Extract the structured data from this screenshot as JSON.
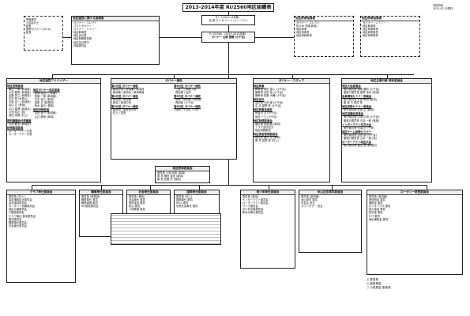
{
  "header": {
    "title": "2013-2014年度 RI/2560地区組織表",
    "meta_top": "内部資料",
    "meta_bottom": "2013.07.03現在"
  },
  "ri": {
    "line1": "R I （2013-14年度）",
    "line2": "会 長 ロン D.バートン(ノーマン)"
  },
  "governor": {
    "line1": "R I D2560 （2013-2014年度）",
    "line2": "ガバナー 山崎 聖輔 (小千谷)"
  },
  "left_dashed": {
    "lines": [
      "財務委員",
      "公認会計士",
      "議長",
      "国際ガバナンス(ICG)",
      "議長"
    ]
  },
  "left_upper": {
    "title": "地区運営に関する指導者",
    "lines": [
      "ガバナー・エレクト",
      "パストガバナー",
      "ガバナー・ノミニー",
      "地区幹事長",
      "地区会計長",
      "地区財務委員長",
      "地区会計長付",
      "評議委員会"
    ]
  },
  "right_upper_1": {
    "title": "地区研修指導者",
    "lines": [
      "ガバナー・エレクト",
      "佐々木 芳雄(新潟)",
      "地区幹事",
      "地区研修長",
      "地区研修幹事"
    ]
  },
  "right_upper_2": {
    "title": "地区研修指導者",
    "lines": [
      "ガバナー・ノミニー",
      "地区幹事長",
      "地区研修幹事",
      "地区研修委員",
      "地区研修委員"
    ]
  },
  "col_adviser": {
    "title": "地区運営アドバイザー",
    "sections": [
      {
        "head": "地区諮問委員",
        "rows": [
          "東山 一郎 (新潟南)",
          "大島 勝男 (新潟東)",
          "遠藤 秀之 (新発田)",
          "石本 豊 (糸魚川)",
          "中嶋 清一 (新潟西)",
          "谷口 正 (長岡)",
          "山口 康博 (新潟北)",
          "川西 成正 (燕)",
          "西田 幸雄 (村上)"
        ]
      },
      {
        "head": "地区ガバナー指名委員",
        "rows": [
          "関澤 信吾 (三条南)",
          "佐藤 一郎 (新潟東)",
          "石本 裕之 (新潟)",
          "高野 正 (新発田)",
          "鈴木 喜代 (長岡)"
        ]
      },
      {
        "head": "地区研修委員",
        "rows": [
          "吉田 幸一 (新潟東)",
          "山口 勝彦 (新潟)"
        ]
      },
      {
        "head": "規則審議会代表議員",
        "rows": [
          "山岸 敏夫 (新潟北)"
        ]
      },
      {
        "head": "紀律事項委員",
        "rows": [
          "ローターアクト代表",
          "ローターアクト代表"
        ]
      }
    ]
  },
  "col_gov_support": {
    "title": "ガバナー補佐",
    "groups": [
      {
        "head": "第1分区 ガバナー補佐",
        "rows": [
          "新潟中央 / 新潟東 / 新潟西",
          "新潟南 / 新潟北 / 新潟東南"
        ]
      },
      {
        "head": "第2分区 ガバナー補佐",
        "rows": [
          "新潟西 / 新潟南",
          "新潟 / 新潟中央"
        ]
      },
      {
        "head": "第3分区 ガバナー補佐",
        "rows": [
          "新発田 / 新発田中央",
          "村上 / 豊栄"
        ]
      },
      {
        "head": "第4分区 ガバナー補佐",
        "rows": [
          "三条 / 三条南 / 燕",
          "燕西蒲 / 加茂"
        ]
      },
      {
        "head": "第5分区 ガバナー補佐",
        "rows": [
          "長岡 / 長岡東 / 長岡西",
          "長岡南 / 小千谷"
        ]
      },
      {
        "head": "第6分区 ガバナー補佐",
        "rows": [
          "柏崎 / 十日町 / 小出"
        ]
      }
    ],
    "footer_title": "地区研修委員会",
    "footer_rows": [
      "委員長 小林 晴男 (新潟)",
      "委 員 梅田 重信 (新潟)",
      "委 員 佐藤 清 (長岡)"
    ]
  },
  "col_staff": {
    "title": "ガバナー・スタッフ",
    "sections": [
      {
        "head": "地区幹事",
        "rows": [
          "幹事長 岡田 直人 (小千谷)",
          "副幹事 吉田 浩 (小千谷)",
          "副幹事 佐藤 大輔 (小千谷)"
        ]
      },
      {
        "head": "地区会計",
        "rows": [
          "会計長 土田 巌 (小千谷)",
          "会 計 星野 昇 (小千谷)"
        ]
      },
      {
        "head": "地区幹事長補佐",
        "rows": [
          "長谷川 亨 (小千谷)",
          "坂井 一之 (小千谷)"
        ]
      },
      {
        "head": "地区財務委員会",
        "rows": [
          "委員長 佐藤 勉 (新潟)",
          "クラブ会計担当",
          "地区財務委員"
        ]
      },
      {
        "head": "地区資金管理委員会",
        "rows": [
          "委員長 渡辺 正 (新潟)",
          "委 員 高野 修 (村上)"
        ]
      }
    ]
  },
  "col_exec": {
    "title": "地区主要行事 特別委員会",
    "sections": [
      {
        "head": "地区大会委員会",
        "rows": [
          "実行委員長 相馬 勝則 (小千谷)",
          "副実行委員長 星野 浩司 (新潟)"
        ]
      },
      {
        "head": "会員増強セミナー委員会",
        "rows": [
          "実行委員長 石田 幸治 (新潟)",
          "副 実 行 委員 長"
        ]
      },
      {
        "head": "地区研修セミナー委員会",
        "rows": [
          "実行委員長 杉原 正 (新潟)"
        ]
      },
      {
        "head": "地区協議会委員会",
        "rows": [
          "実行委員長 中澤 正明 (小千谷)",
          "副実行委員長 鳥羽 一郎 (長岡)"
        ]
      },
      {
        "head": "インターアクト年次大会",
        "rows": [
          "実行委員長 安達 正 (三条)"
        ]
      },
      {
        "head": "地区チーム研修セミナー",
        "rows": [
          "実行委員長 吉田 浩 (小千谷)",
          "副実行委員長 山本 一雄 (燕)"
        ]
      },
      {
        "head": "ローターアクト地区大会",
        "rows": [
          "実行委員長 森山 誠 (新発田)"
        ]
      }
    ]
  },
  "bottom": [
    {
      "title": "クラブ奉仕委員会",
      "rows": [
        "委員長 (村上)",
        "会員増強拡大委員会",
        "会員維持委員会",
        "ロータリー情報委員会",
        "地区広報委員会",
        "IT推進委員会",
        "クラブ奉仕 基本委員会",
        "雑誌委員会",
        "職業奉仕委員会",
        "社会奉仕委員会"
      ]
    },
    {
      "title": "職業奉仕委員会",
      "rows": [
        "委員長 (新発田)",
        "職業奉仕 委員",
        "職業倫理 委員",
        "RLI推進委員会"
      ]
    },
    {
      "title": "社会奉仕委員会",
      "rows": [
        "委員長 (長岡)",
        "社会奉仕 委員",
        "環境保全 委員",
        "防災 委員",
        "人間尊重 委員"
      ]
    },
    {
      "title": "国際奉仕委員会",
      "rows": [
        "委員長 (村上)",
        "国際奉仕 委員",
        "WCS 委員",
        "世界社会奉仕 委員"
      ]
    },
    {
      "title": "青少年奉仕委員会",
      "rows": [
        "委員長 (新潟)",
        "インターアクト委員会",
        "ローターアクト委員会",
        "ライラ委員会",
        "青少年交換委員会",
        "新世代奉仕委員会"
      ]
    },
    {
      "title": "米山記念奨学委員会",
      "rows": [
        "委員長 (新潟東)",
        "米山奨学 委員",
        "学友会 担当",
        "カウンセラー 担当"
      ]
    },
    {
      "title": "ロータリー財団委員会",
      "rows": [
        "委員長 (新潟東)",
        "財団資金 委員",
        "補助金 委員",
        "ポリオプラス 委員",
        "恒久基金 委員",
        "奨学金 委員",
        "VTT 委員",
        "地区補助金 委員"
      ]
    }
  ],
  "legend": [
    "◎ 委員長",
    "◎ 副委員長",
    "○ 小委員会 委員長"
  ]
}
